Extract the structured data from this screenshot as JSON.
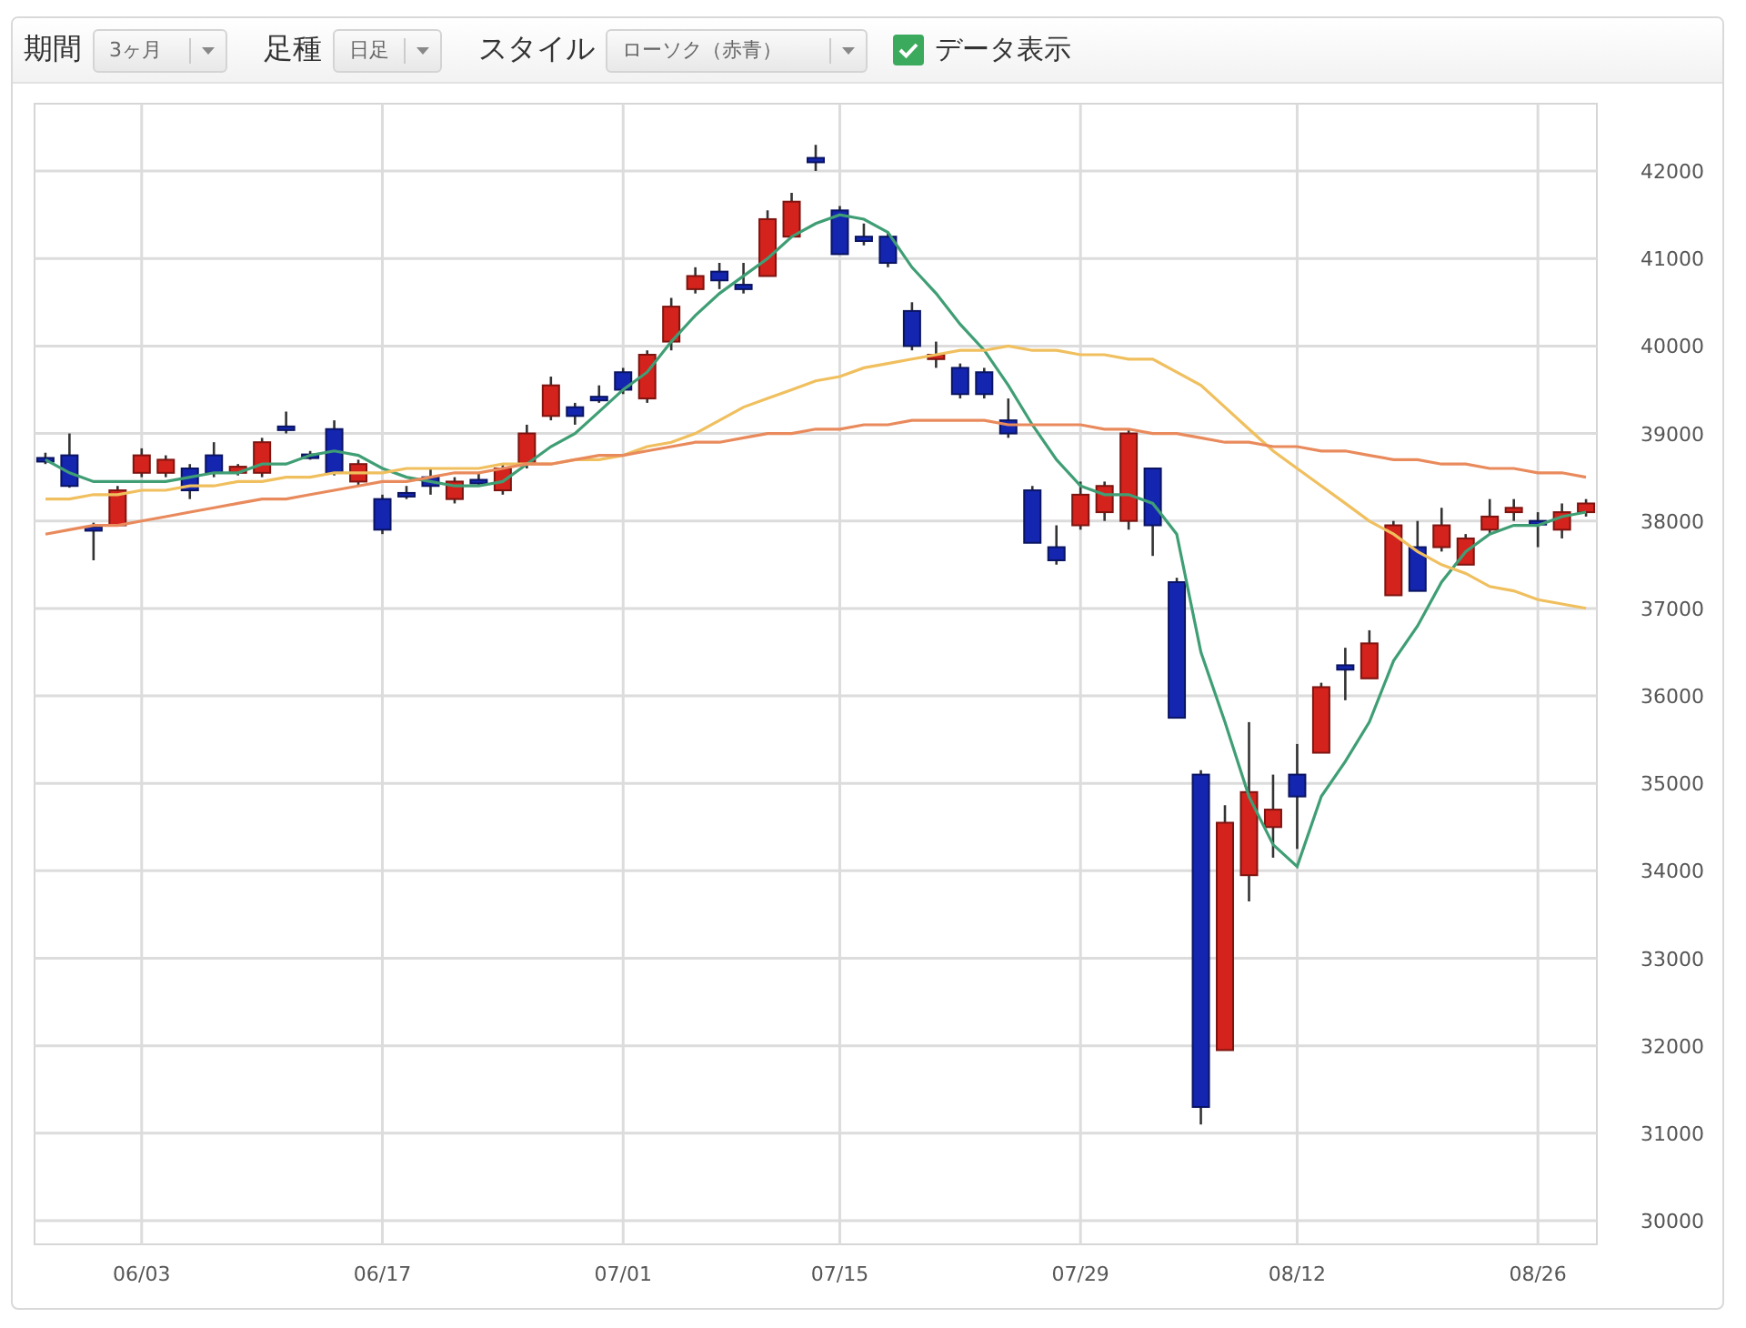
{
  "toolbar": {
    "period": {
      "label": "期間",
      "value": "3ヶ月"
    },
    "bar_type": {
      "label": "足種",
      "value": "日足"
    },
    "style": {
      "label": "スタイル",
      "value": "ローソク（赤青）"
    },
    "data_display": {
      "label": "データ表示",
      "checked": true
    }
  },
  "chart": {
    "chart_data": {
      "type": "candlestick",
      "grid": true,
      "ylim": [
        29730,
        42770
      ],
      "categories": [
        null,
        null,
        null,
        null,
        "06/03",
        null,
        null,
        null,
        null,
        null,
        null,
        null,
        null,
        null,
        "06/17",
        null,
        null,
        null,
        null,
        null,
        null,
        null,
        null,
        null,
        "07/01",
        null,
        null,
        null,
        null,
        null,
        null,
        null,
        null,
        "07/15",
        null,
        null,
        null,
        null,
        null,
        null,
        null,
        null,
        null,
        "07/29",
        null,
        null,
        null,
        null,
        null,
        null,
        null,
        null,
        "08/12",
        null,
        null,
        null,
        null,
        null,
        null,
        null,
        null,
        null,
        "08/26",
        null,
        null
      ],
      "yticks": [
        30000,
        31000,
        32000,
        33000,
        34000,
        35000,
        36000,
        37000,
        38000,
        39000,
        40000,
        41000,
        42000
      ],
      "ohlc": [
        [
          38720,
          38780,
          38650,
          38700
        ],
        [
          38750,
          39000,
          38380,
          38400
        ],
        [
          37930,
          37980,
          37550,
          37920
        ],
        [
          37950,
          38400,
          37950,
          38350
        ],
        [
          38550,
          38830,
          38500,
          38750
        ],
        [
          38550,
          38750,
          38500,
          38700
        ],
        [
          38600,
          38650,
          38250,
          38350
        ],
        [
          38750,
          38900,
          38500,
          38550
        ],
        [
          38550,
          38650,
          38520,
          38620
        ],
        [
          38550,
          38950,
          38500,
          38900
        ],
        [
          39080,
          39250,
          39000,
          39050
        ],
        [
          38760,
          38800,
          38700,
          38750
        ],
        [
          39050,
          39150,
          38520,
          38550
        ],
        [
          38450,
          38700,
          38400,
          38650
        ],
        [
          38250,
          38300,
          37850,
          37900
        ],
        [
          38320,
          38400,
          38250,
          38300
        ],
        [
          38500,
          38600,
          38300,
          38400
        ],
        [
          38250,
          38500,
          38200,
          38450
        ],
        [
          38470,
          38550,
          38400,
          38450
        ],
        [
          38350,
          38650,
          38300,
          38600
        ],
        [
          38650,
          39100,
          38600,
          39000
        ],
        [
          39200,
          39650,
          39150,
          39550
        ],
        [
          39300,
          39350,
          39100,
          39200
        ],
        [
          39420,
          39550,
          39350,
          39400
        ],
        [
          39700,
          39750,
          39450,
          39500
        ],
        [
          39400,
          39950,
          39350,
          39900
        ],
        [
          40050,
          40550,
          39950,
          40450
        ],
        [
          40650,
          40900,
          40600,
          40800
        ],
        [
          40850,
          40950,
          40650,
          40750
        ],
        [
          40700,
          40950,
          40600,
          40650
        ],
        [
          40800,
          41550,
          40800,
          41450
        ],
        [
          41250,
          41750,
          41250,
          41650
        ],
        [
          42150,
          42300,
          42000,
          42100
        ],
        [
          41550,
          41600,
          41050,
          41050
        ],
        [
          41250,
          41400,
          41150,
          41200
        ],
        [
          41250,
          41300,
          40900,
          40950
        ],
        [
          40400,
          40500,
          39950,
          40000
        ],
        [
          39850,
          40050,
          39750,
          39900
        ],
        [
          39750,
          39800,
          39400,
          39450
        ],
        [
          39700,
          39750,
          39400,
          39450
        ],
        [
          39150,
          39400,
          38950,
          39000
        ],
        [
          38350,
          38400,
          37750,
          37750
        ],
        [
          37700,
          37950,
          37500,
          37550
        ],
        [
          37950,
          38450,
          37900,
          38300
        ],
        [
          38100,
          38450,
          38000,
          38400
        ],
        [
          38000,
          39050,
          37900,
          39000
        ],
        [
          38600,
          38600,
          37600,
          37950
        ],
        [
          37300,
          37350,
          35750,
          35750
        ],
        [
          35100,
          35150,
          31100,
          31300
        ],
        [
          31950,
          34750,
          31950,
          34550
        ],
        [
          33950,
          35700,
          33650,
          34900
        ],
        [
          34500,
          35100,
          34150,
          34700
        ],
        [
          35100,
          35450,
          34250,
          34850
        ],
        [
          35350,
          36150,
          35350,
          36100
        ],
        [
          36350,
          36550,
          35950,
          36300
        ],
        [
          36200,
          36750,
          36200,
          36600
        ],
        [
          37150,
          38000,
          37150,
          37950
        ],
        [
          37700,
          38000,
          37200,
          37200
        ],
        [
          37700,
          38150,
          37650,
          37950
        ],
        [
          37500,
          37850,
          37500,
          37800
        ],
        [
          37900,
          38250,
          37850,
          38050
        ],
        [
          38100,
          38250,
          38000,
          38150
        ],
        [
          38000,
          38100,
          37700,
          37980
        ],
        [
          37900,
          38200,
          37800,
          38100
        ],
        [
          38100,
          38250,
          38050,
          38200
        ]
      ],
      "series": [
        {
          "type": "line",
          "color": "#3f9e74",
          "values": [
            38700,
            38550,
            38450,
            38450,
            38450,
            38450,
            38500,
            38550,
            38550,
            38650,
            38650,
            38750,
            38800,
            38750,
            38600,
            38500,
            38450,
            38400,
            38400,
            38450,
            38650,
            38850,
            39000,
            39250,
            39500,
            39700,
            40050,
            40350,
            40600,
            40800,
            41000,
            41250,
            41400,
            41500,
            41450,
            41300,
            40900,
            40600,
            40250,
            39950,
            39550,
            39100,
            38700,
            38400,
            38300,
            38300,
            38200,
            37850,
            36500,
            35700,
            34850,
            34300,
            34050,
            34850,
            35250,
            35700,
            36400,
            36800,
            37300,
            37650,
            37850,
            37950,
            37950,
            38050,
            38100
          ]
        },
        {
          "type": "line",
          "color": "#f0bf5e",
          "values": [
            38250,
            38250,
            38300,
            38300,
            38350,
            38350,
            38400,
            38400,
            38450,
            38450,
            38500,
            38500,
            38550,
            38550,
            38550,
            38600,
            38600,
            38600,
            38600,
            38650,
            38650,
            38650,
            38700,
            38700,
            38750,
            38850,
            38900,
            39000,
            39150,
            39300,
            39400,
            39500,
            39600,
            39650,
            39750,
            39800,
            39850,
            39900,
            39950,
            39950,
            40000,
            39950,
            39950,
            39900,
            39900,
            39850,
            39850,
            39700,
            39550,
            39300,
            39050,
            38800,
            38600,
            38400,
            38200,
            38000,
            37850,
            37650,
            37500,
            37400,
            37250,
            37200,
            37100,
            37050,
            37000
          ]
        },
        {
          "type": "line",
          "color": "#e98a5c",
          "values": [
            37850,
            37900,
            37950,
            37950,
            38000,
            38050,
            38100,
            38150,
            38200,
            38250,
            38250,
            38300,
            38350,
            38400,
            38450,
            38450,
            38500,
            38550,
            38550,
            38600,
            38650,
            38650,
            38700,
            38750,
            38750,
            38800,
            38850,
            38900,
            38900,
            38950,
            39000,
            39000,
            39050,
            39050,
            39100,
            39100,
            39150,
            39150,
            39150,
            39150,
            39100,
            39100,
            39100,
            39100,
            39050,
            39050,
            39000,
            39000,
            38950,
            38900,
            38900,
            38850,
            38850,
            38800,
            38800,
            38750,
            38700,
            38700,
            38650,
            38650,
            38600,
            38600,
            38550,
            38550,
            38500
          ]
        }
      ]
    }
  }
}
